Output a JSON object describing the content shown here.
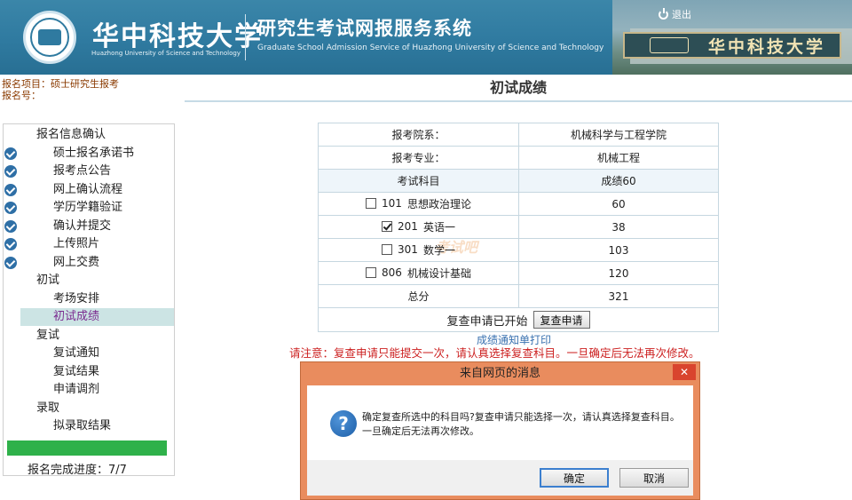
{
  "header": {
    "university_name": "华中科技大学",
    "university_en": "Huazhong University of Science and Technology",
    "system_title": "研究生考试网报服务系统",
    "system_en": "Graduate School Admission Service of Huazhong University of Science and Technology",
    "gate_text": "华中科技大学",
    "logout_label": "退出"
  },
  "project_info": {
    "project_label": "报名项目：",
    "project_value": "硕士研究生报考",
    "reg_no_label": "报名号："
  },
  "page_title": "初试成绩",
  "sidebar": {
    "sections": [
      {
        "label": "报名信息确认"
      },
      {
        "label": "初试"
      },
      {
        "label": "复试"
      },
      {
        "label": "录取"
      }
    ],
    "items": [
      {
        "label": "硕士报名承诺书",
        "completed": true
      },
      {
        "label": "报考点公告",
        "completed": true
      },
      {
        "label": "网上确认流程",
        "completed": true
      },
      {
        "label": "学历学籍验证",
        "completed": true
      },
      {
        "label": "确认并提交",
        "completed": true
      },
      {
        "label": "上传照片",
        "completed": true
      },
      {
        "label": "网上交费",
        "completed": true
      },
      {
        "label": "考场安排"
      },
      {
        "label": "初试成绩",
        "active": true
      },
      {
        "label": "复试通知"
      },
      {
        "label": "复试结果"
      },
      {
        "label": "申请调剂"
      },
      {
        "label": "拟录取结果"
      }
    ],
    "progress_label": "报名完成进度：7/7",
    "progress_fraction": 1.0
  },
  "scores": {
    "dept_label": "报考院系：",
    "dept_value": "机械科学与工程学院",
    "major_label": "报考专业：",
    "major_value": "机械工程",
    "subject_header": "考试科目",
    "score_header": "成绩60",
    "subjects": [
      {
        "code": "101",
        "name": "思想政治理论",
        "score": "60",
        "checked": false
      },
      {
        "code": "201",
        "name": "英语一",
        "score": "38",
        "checked": true
      },
      {
        "code": "301",
        "name": "数学一",
        "score": "103",
        "checked": false
      },
      {
        "code": "806",
        "name": "机械设计基础",
        "score": "120",
        "checked": false
      }
    ],
    "total_label": "总分",
    "total_value": "321",
    "review_status": "复查申请已开始",
    "review_button": "复查申请",
    "print_link": "成绩通知单打印",
    "notice": "请注意：复查申请只能提交一次，请认真选择复查科目。一旦确定后无法再次修改。"
  },
  "dialog": {
    "title": "来自网页的消息",
    "message": "确定复查所选中的科目吗?复查申请只能选择一次，请认真选择复查科目。一旦确定后无法再次修改。",
    "ok_label": "确定",
    "cancel_label": "取消",
    "close_label": "✕"
  },
  "watermark": "考试吧",
  "colors": {
    "header_bg": "#2f7aa0",
    "progress": "#2fb14a",
    "notice": "#cc1f1f",
    "dialog_frame": "#e98c5e",
    "check_icon": "#2e6fa6"
  }
}
